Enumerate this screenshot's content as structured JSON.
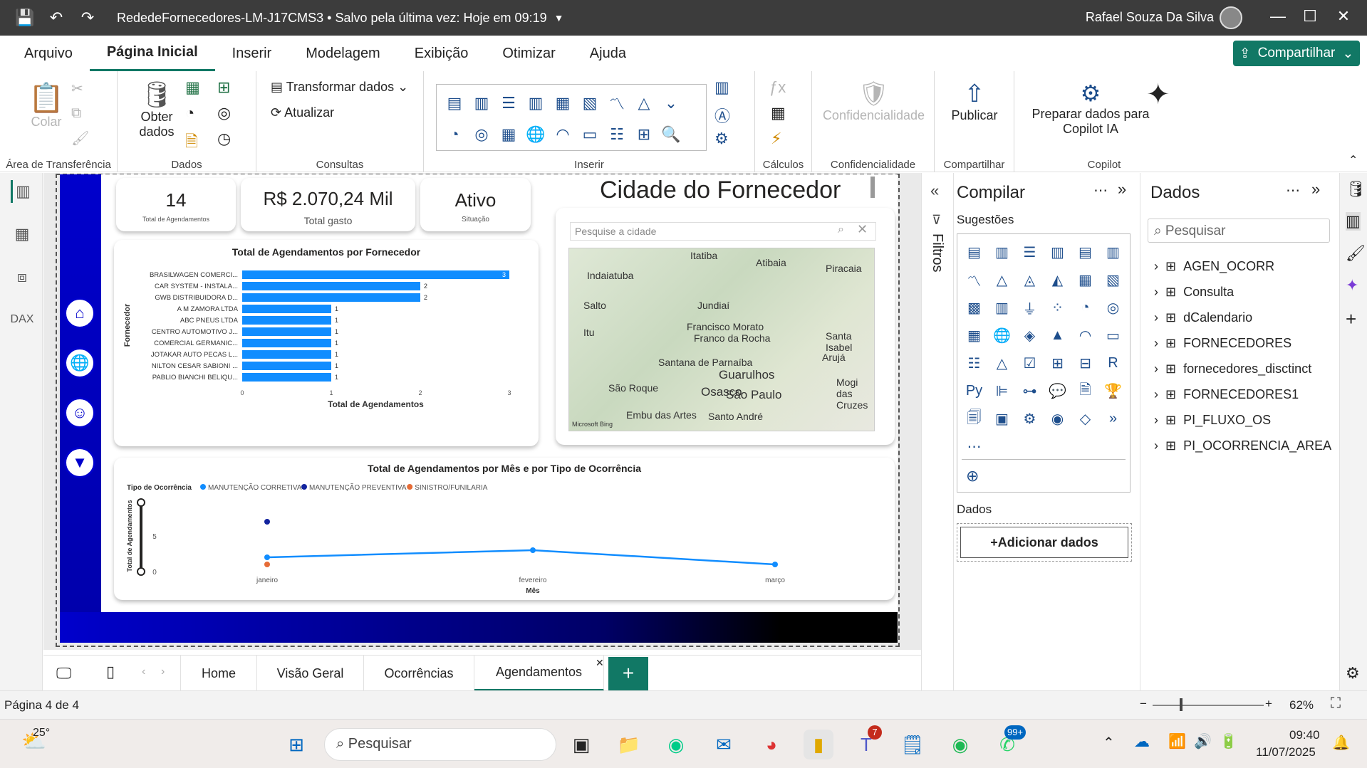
{
  "titlebar": {
    "title": "RededeFornecedores-LM-J17CMS3 • Salvo pela última vez: Hoje em 09:19",
    "user": "Rafael Souza Da Silva"
  },
  "menu": [
    "Arquivo",
    "Página Inicial",
    "Inserir",
    "Modelagem",
    "Exibição",
    "Otimizar",
    "Ajuda"
  ],
  "share_label": "Compartilhar",
  "ribbon": {
    "paste": "Colar",
    "get_data": "Obter dados",
    "transform": "Transformar dados",
    "refresh": "Atualizar",
    "confidentiality": "Confidencialidade",
    "publish": "Publicar",
    "copilot_prep": "Preparar dados para Copilot IA",
    "groups": {
      "clipboard": "Área de Transferência",
      "data": "Dados",
      "queries": "Consultas",
      "insert": "Inserir",
      "calc": "Cálculos",
      "conf": "Confidencialidade",
      "share": "Compartilhar",
      "copilot": "Copilot"
    }
  },
  "kpis": [
    {
      "value": "14",
      "label": "Total de Agendamentos"
    },
    {
      "value": "R$ 2.070,24 Mil",
      "label": "Total gasto"
    },
    {
      "value": "Ativo",
      "label": "Situação"
    }
  ],
  "map": {
    "title": "Cidade do Fornecedor",
    "search_placeholder": "Pesquise a cidade",
    "places": [
      "Itatiba",
      "Indaiatuba",
      "Atibaia",
      "Piracaia",
      "Salto",
      "Jundiaí",
      "Francisco Morato",
      "Franco da Rocha",
      "Santa Isabel",
      "Itu",
      "Santana de Parnaíba",
      "Guarulhos",
      "Arujá",
      "Mogi das Cruzes",
      "São Roque",
      "Osasco",
      "São Paulo",
      "Embu das Artes",
      "Santo André"
    ],
    "credit": "Microsoft Bing"
  },
  "chart_data": [
    {
      "type": "bar",
      "title": "Total de Agendamentos por Fornecedor",
      "xlabel": "Total de Agendamentos",
      "ylabel": "Fornecedor",
      "categories": [
        "BRASILWAGEN COMERCI...",
        "CAR SYSTEM - INSTALA...",
        "GWB DISTRIBUIDORA D...",
        "A M ZAMORA LTDA",
        "ABC PNEUS LTDA",
        "CENTRO AUTOMOTIVO J...",
        "COMERCIAL GERMANIC...",
        "JOTAKAR AUTO PECAS L...",
        "NILTON CESAR SABIONI ...",
        "PABLIO BIANCHI BELIQU..."
      ],
      "values": [
        3,
        2,
        2,
        1,
        1,
        1,
        1,
        1,
        1,
        1
      ],
      "xlim": [
        0,
        3
      ],
      "xticks": [
        "0",
        "1",
        "2",
        "3"
      ],
      "color": "#118dff"
    },
    {
      "type": "line",
      "title": "Total de Agendamentos por Mês e por Tipo de Ocorrência",
      "xlabel": "Mês",
      "ylabel": "Total de Agendamentos",
      "legend_title": "Tipo de Ocorrência",
      "categories": [
        "janeiro",
        "fevereiro",
        "março"
      ],
      "yticks": [
        "0",
        "5"
      ],
      "ylim": [
        0,
        10
      ],
      "series": [
        {
          "name": "MANUTENÇÃO CORRETIVA",
          "color": "#118dff",
          "values": [
            2,
            3,
            1
          ]
        },
        {
          "name": "MANUTENÇÃO PREVENTIVA",
          "color": "#12239e",
          "values": [
            7,
            null,
            null
          ]
        },
        {
          "name": "SINISTRO/FUNILARIA",
          "color": "#e66c37",
          "values": [
            1,
            null,
            null
          ]
        }
      ]
    }
  ],
  "compile": {
    "title": "Compilar",
    "suggestions": "Sugestões",
    "data_label": "Dados",
    "add_data": "+Adicionar dados"
  },
  "filters_label": "Filtros",
  "datapane": {
    "title": "Dados",
    "search_placeholder": "Pesquisar",
    "tables": [
      "AGEN_OCORR",
      "Consulta",
      "dCalendario",
      "FORNECEDORES",
      "fornecedores_disctinct",
      "FORNECEDORES1",
      "PI_FLUXO_OS",
      "PI_OCORRENCIA_AREA"
    ]
  },
  "tabs": [
    "Home",
    "Visão Geral",
    "Ocorrências",
    "Agendamentos"
  ],
  "status": {
    "page": "Página 4 de 4",
    "zoom": "62%"
  },
  "taskbar": {
    "temp": "25°",
    "search": "Pesquisar",
    "time": "09:40",
    "date": "11/07/2025",
    "teams_badge": "7",
    "whatsapp_badge": "99+"
  }
}
